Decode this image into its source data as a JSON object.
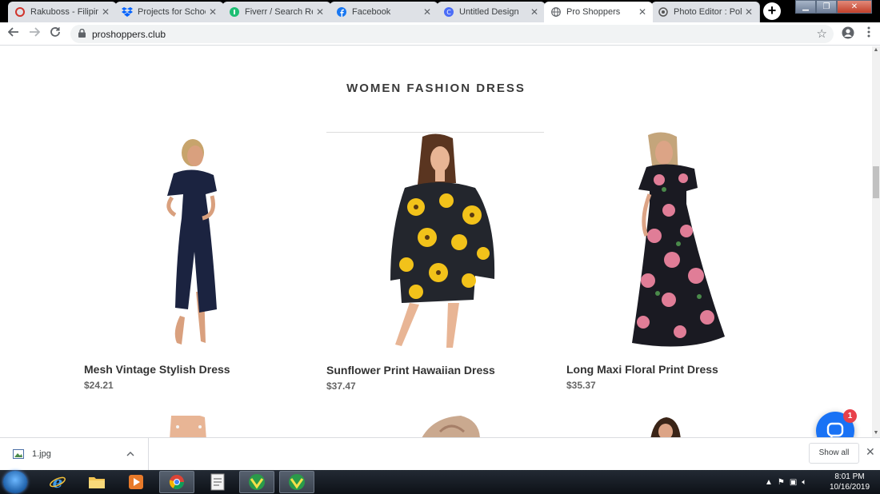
{
  "browser": {
    "tabs": [
      {
        "title": "Rakuboss - Filipino",
        "icon": "rakuboss-icon",
        "active": false
      },
      {
        "title": "Projects for School",
        "icon": "dropbox-icon",
        "active": false
      },
      {
        "title": "Fiverr / Search Resu",
        "icon": "fiverr-icon",
        "active": false
      },
      {
        "title": "Facebook",
        "icon": "facebook-icon",
        "active": false
      },
      {
        "title": "Untitled Design",
        "icon": "canva-icon",
        "active": false
      },
      {
        "title": "Pro Shoppers",
        "icon": "globe-icon",
        "active": true
      },
      {
        "title": "Photo Editor : Polar",
        "icon": "polarr-icon",
        "active": false
      }
    ],
    "new_tab_label": "+",
    "close_glyph": "✕",
    "url": "proshoppers.club"
  },
  "page": {
    "section_title": "WOMEN FASHION DRESS",
    "products": [
      {
        "name": "Mesh Vintage Stylish Dress",
        "price": "$24.21",
        "colors": {
          "dress": "#1b2340",
          "skin": "#d9a07e",
          "hair": "#c7a46c"
        }
      },
      {
        "name": "Sunflower Print Hawaiian Dress",
        "price": "$37.47",
        "colors": {
          "dress": "#23262d",
          "print": "#f2c21a",
          "skin": "#e8b595",
          "hair": "#5a3520"
        }
      },
      {
        "name": "Long Maxi Floral Print Dress",
        "price": "$35.37",
        "colors": {
          "dress": "#1a1a22",
          "print": "#e07d97",
          "skin": "#dca486",
          "hair": "#c4a57b"
        }
      }
    ],
    "chat_badge": "1"
  },
  "downloads": {
    "file_name": "1.jpg",
    "show_all_label": "Show all",
    "close_glyph": "✕"
  },
  "taskbar": {
    "time": "8:01 PM",
    "date": "10/16/2019",
    "apps": [
      "internet-explorer-icon",
      "file-explorer-icon",
      "media-player-icon",
      "chrome-icon",
      "document-icon",
      "app-icon",
      "app-icon"
    ]
  },
  "colors": {
    "accent": "#1972f5",
    "badge": "#e8404a"
  }
}
